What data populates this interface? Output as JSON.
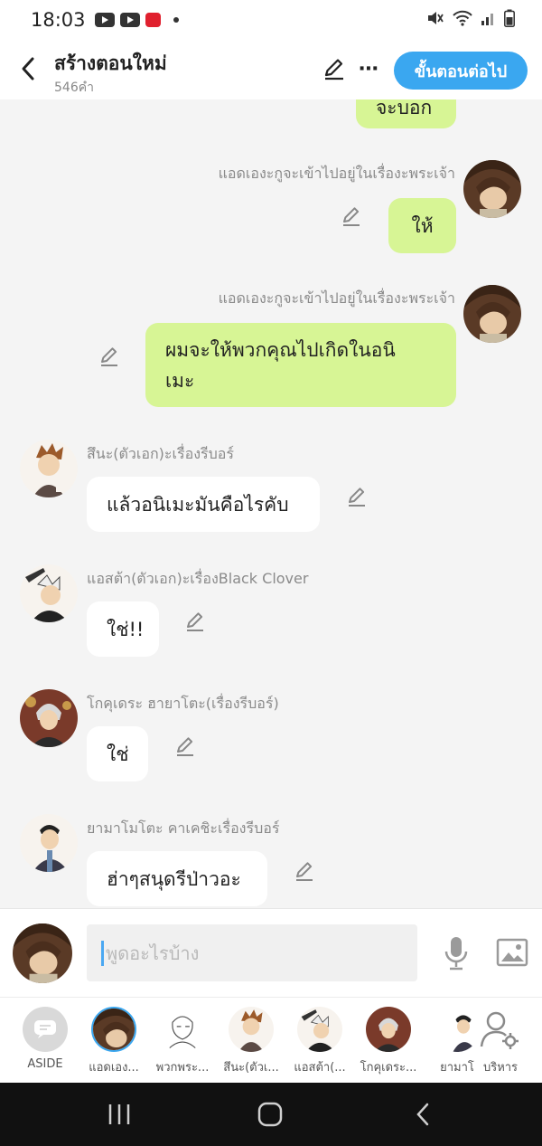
{
  "status_bar": {
    "time": "18:03",
    "icons": [
      "youtube-icon",
      "youtube-icon",
      "app-c-icon",
      "dot-icon",
      "mute-icon",
      "wifi-icon",
      "signal-icon",
      "battery-icon"
    ]
  },
  "header": {
    "title": "สร้างตอนใหม่",
    "word_count": "546คำ",
    "next_button": "ขั้นตอนต่อไป",
    "more_icon": "⋯",
    "accent_color": "#3aa7f0"
  },
  "messages": [
    {
      "side": "right",
      "speaker": "",
      "text": "จะบอก",
      "partial": true
    },
    {
      "side": "right",
      "speaker": "แอดเองะกูจะเข้าไปอยู่ในเรื่องะพระเจ้า",
      "text": "ให้"
    },
    {
      "side": "right",
      "speaker": "แอดเองะกูจะเข้าไปอยู่ในเรื่องะพระเจ้า",
      "text_lines": [
        "ผมจะให้พวกคุณไปเกิดในอนิ",
        "เมะ"
      ]
    },
    {
      "side": "left",
      "speaker": "สึนะ(ตัวเอก)ะเรื่องรีบอร์",
      "text": "แล้วอนิเมะมันคือไรคับ"
    },
    {
      "side": "left",
      "speaker": "แอสต้า(ตัวเอก)ะเรื่องBlack Clover",
      "text": "ใช่!!"
    },
    {
      "side": "left",
      "speaker": "โกคุเดระ ฮายาโตะ(เรื่องรีบอร์)",
      "text": "ใช่"
    },
    {
      "side": "left",
      "speaker": "ยามาโมโตะ คาเคชิะเรื่องรีบอร์",
      "text": "ฮ่าๆสนุดรีป่าวอะ"
    }
  ],
  "input": {
    "placeholder": "พูดอะไรบ้าง"
  },
  "characters": [
    {
      "label": "ASIDE",
      "icon": "chat-bubble-icon"
    },
    {
      "label": "แอดเอง..."
    },
    {
      "label": "พวกพระ..."
    },
    {
      "label": "สึนะ(ตัวเ..."
    },
    {
      "label": "แอสต้า(..."
    },
    {
      "label": "โกคุเดระ..."
    },
    {
      "label": "ยามาโ"
    },
    {
      "label": "บริหาร",
      "icon": "manage-user-icon"
    }
  ],
  "colors": {
    "bubble_me": "#d7f595",
    "bubble_them": "#ffffff",
    "chat_bg": "#f4f4f4"
  }
}
